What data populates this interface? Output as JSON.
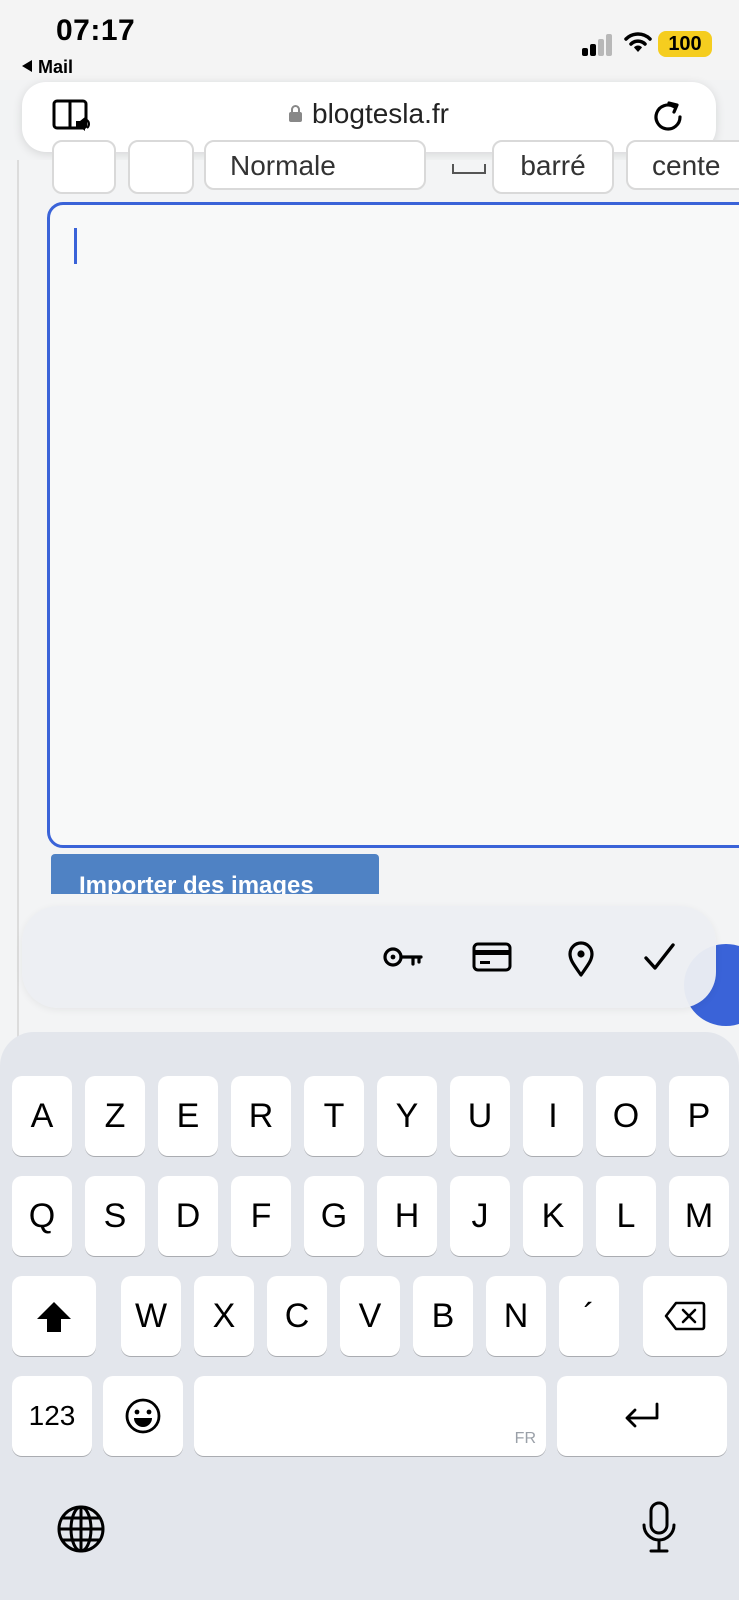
{
  "status_bar": {
    "time": "07:17",
    "back_app": "Mail",
    "battery": "100"
  },
  "browser": {
    "url": "blogtesla.fr"
  },
  "editor_toolbar": {
    "format_select": "Normale",
    "strike_label": "barré",
    "align_label": "cente"
  },
  "editor": {
    "import_label": "Importer des images"
  },
  "autofill_bar": {
    "icons": [
      "key-icon",
      "credit-card-icon",
      "location-pin-icon",
      "checkmark-icon"
    ]
  },
  "keyboard": {
    "row1": [
      "A",
      "Z",
      "E",
      "R",
      "T",
      "Y",
      "U",
      "I",
      "O",
      "P"
    ],
    "row2": [
      "Q",
      "S",
      "D",
      "F",
      "G",
      "H",
      "J",
      "K",
      "L",
      "M"
    ],
    "row3": [
      "W",
      "X",
      "C",
      "V",
      "B",
      "N",
      "´"
    ],
    "numbers_label": "123",
    "space_lang": "FR"
  },
  "colors": {
    "accent": "#3a63d8",
    "import_button": "#4f82c4",
    "battery": "#f5cd1f"
  }
}
